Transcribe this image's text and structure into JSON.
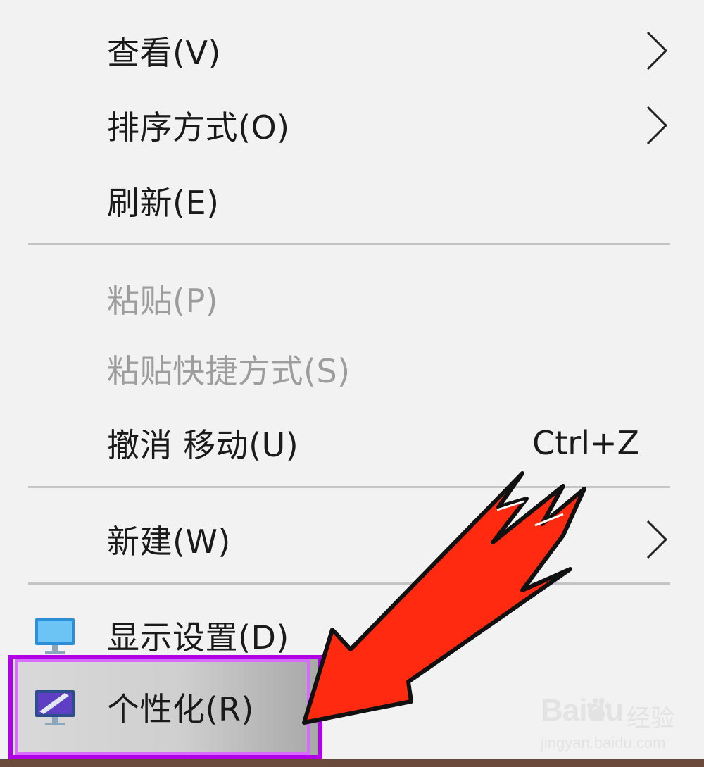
{
  "context_menu": {
    "items": [
      {
        "label": "查看(V)",
        "has_submenu": true,
        "enabled": true
      },
      {
        "label": "排序方式(O)",
        "has_submenu": true,
        "enabled": true
      },
      {
        "label": "刷新(E)",
        "has_submenu": false,
        "enabled": true
      },
      {
        "label": "粘贴(P)",
        "has_submenu": false,
        "enabled": false
      },
      {
        "label": "粘贴快捷方式(S)",
        "has_submenu": false,
        "enabled": false
      },
      {
        "label": "撤消 移动(U)",
        "shortcut": "Ctrl+Z",
        "has_submenu": false,
        "enabled": true
      },
      {
        "label": "新建(W)",
        "has_submenu": true,
        "enabled": true
      },
      {
        "label": "显示设置(D)",
        "icon": "display-settings-icon",
        "has_submenu": false,
        "enabled": true
      },
      {
        "label": "个性化(R)",
        "icon": "personalize-icon",
        "has_submenu": false,
        "enabled": true,
        "highlighted": true
      }
    ]
  },
  "annotation": {
    "type": "red-arrow",
    "points_to": "个性化(R)",
    "color": "#ff2a10",
    "highlight_color": "#b000e8"
  },
  "watermark": {
    "brand": "Baidu",
    "product": "经验",
    "url": "jingyan.baidu.com"
  }
}
